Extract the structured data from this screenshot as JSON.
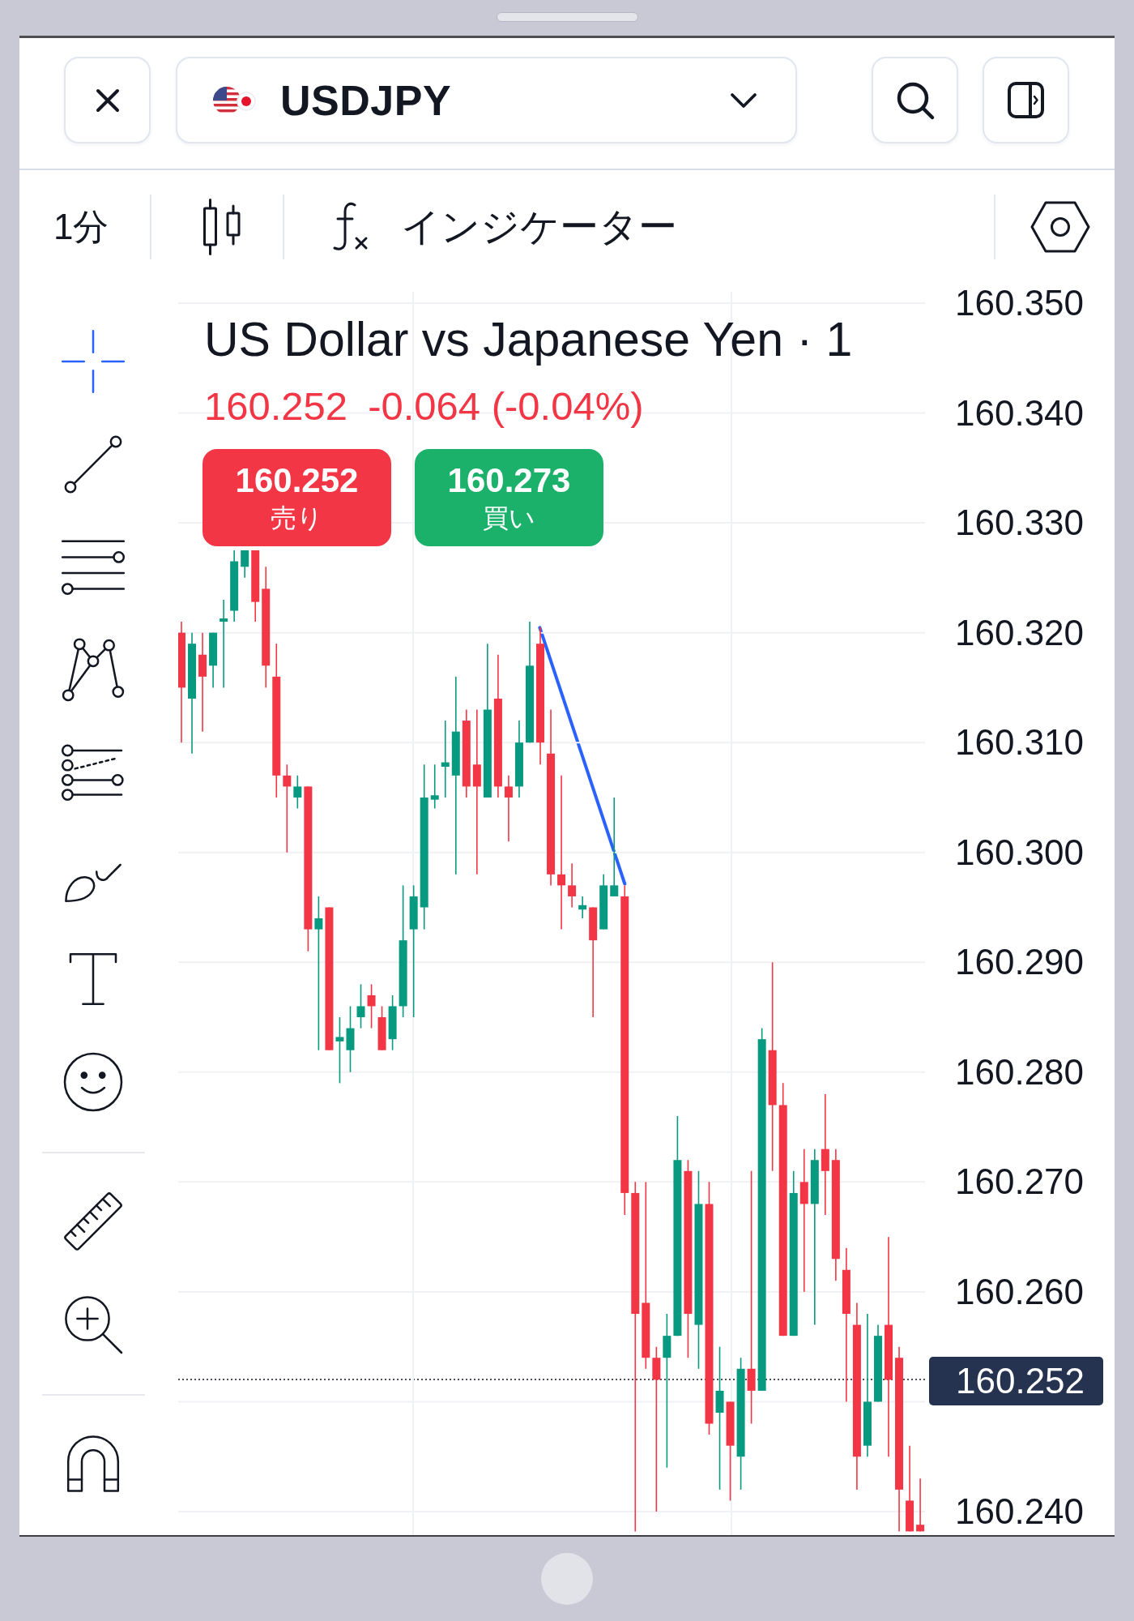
{
  "header": {
    "symbol": "USDJPY"
  },
  "toolbar": {
    "interval": "1分",
    "indicators": "インジケーター"
  },
  "drawing_tool_groups": [
    {
      "tools": [
        {
          "selected": true
        },
        {
          "selected": false
        },
        {
          "selected": false
        },
        {
          "selected": false
        },
        {
          "selected": false
        },
        {
          "selected": false
        },
        {
          "selected": false
        },
        {
          "selected": false
        }
      ]
    },
    {
      "tools": [
        {
          "selected": false
        },
        {
          "selected": false
        }
      ]
    },
    {
      "tools": [
        {
          "selected": false
        }
      ]
    }
  ],
  "chart": {
    "title": "US Dollar vs Japanese Yen · 1",
    "last_price": "160.252",
    "change": "-0.064 (-0.04%)",
    "sell_button": {
      "price": "160.252",
      "label": "売り"
    },
    "buy_button": {
      "price": "160.273",
      "label": "買い"
    },
    "chart_data": {
      "type": "candlestick",
      "grid": true,
      "ohlc": [
        [
          160.32,
          160.321,
          160.31,
          160.315
        ],
        [
          160.314,
          160.32,
          160.309,
          160.319
        ],
        [
          160.318,
          160.32,
          160.311,
          160.316
        ],
        [
          160.317,
          160.32,
          160.315,
          160.32
        ],
        [
          160.321,
          160.323,
          160.315,
          160.3213
        ],
        [
          160.322,
          160.3275,
          160.321,
          160.3265
        ],
        [
          160.326,
          160.3275,
          160.325,
          160.3275
        ],
        [
          160.3275,
          160.3275,
          160.321,
          160.3228
        ],
        [
          160.324,
          160.326,
          160.315,
          160.317
        ],
        [
          160.316,
          160.319,
          160.305,
          160.307
        ],
        [
          160.307,
          160.308,
          160.3,
          160.306
        ],
        [
          160.305,
          160.307,
          160.304,
          160.306
        ],
        [
          160.306,
          160.306,
          160.291,
          160.293
        ],
        [
          160.293,
          160.296,
          160.282,
          160.294
        ],
        [
          160.295,
          160.295,
          160.282,
          160.282
        ],
        [
          160.2828,
          160.285,
          160.279,
          160.2832
        ],
        [
          160.282,
          160.286,
          160.28,
          160.284
        ],
        [
          160.285,
          160.288,
          160.284,
          160.286
        ],
        [
          160.287,
          160.288,
          160.284,
          160.286
        ],
        [
          160.285,
          160.286,
          160.282,
          160.282
        ],
        [
          160.283,
          160.287,
          160.282,
          160.286
        ],
        [
          160.286,
          160.297,
          160.285,
          160.292
        ],
        [
          160.293,
          160.297,
          160.285,
          160.296
        ],
        [
          160.295,
          160.308,
          160.293,
          160.305
        ],
        [
          160.3048,
          160.308,
          160.304,
          160.3052
        ],
        [
          160.3078,
          160.312,
          160.305,
          160.3082
        ],
        [
          160.307,
          160.316,
          160.298,
          160.311
        ],
        [
          160.312,
          160.313,
          160.305,
          160.306
        ],
        [
          160.308,
          160.313,
          160.298,
          160.306
        ],
        [
          160.305,
          160.319,
          160.305,
          160.313
        ],
        [
          160.314,
          160.318,
          160.305,
          160.306
        ],
        [
          160.306,
          160.307,
          160.301,
          160.305
        ],
        [
          160.306,
          160.312,
          160.305,
          160.31
        ],
        [
          160.31,
          160.321,
          160.31,
          160.317
        ],
        [
          160.319,
          160.3205,
          160.308,
          160.31
        ],
        [
          160.309,
          160.313,
          160.297,
          160.298
        ],
        [
          160.298,
          160.307,
          160.293,
          160.297
        ],
        [
          160.297,
          160.299,
          160.295,
          160.296
        ],
        [
          160.2948,
          160.296,
          160.294,
          160.2952
        ],
        [
          160.295,
          160.295,
          160.285,
          160.292
        ],
        [
          160.293,
          160.298,
          160.293,
          160.297
        ],
        [
          160.296,
          160.305,
          160.296,
          160.297
        ],
        [
          160.296,
          160.297,
          160.267,
          160.269
        ],
        [
          160.269,
          160.27,
          160.2382,
          160.258
        ],
        [
          160.259,
          160.27,
          160.253,
          160.254
        ],
        [
          160.254,
          160.255,
          160.24,
          160.252
        ],
        [
          160.254,
          160.258,
          160.244,
          160.256
        ],
        [
          160.256,
          160.276,
          160.256,
          160.272
        ],
        [
          160.271,
          160.272,
          160.254,
          160.258
        ],
        [
          160.257,
          160.271,
          160.253,
          160.268
        ],
        [
          160.268,
          160.27,
          160.247,
          160.248
        ],
        [
          160.249,
          160.255,
          160.242,
          160.251
        ],
        [
          160.25,
          160.25,
          160.241,
          160.246
        ],
        [
          160.245,
          160.254,
          160.242,
          160.253
        ],
        [
          160.253,
          160.271,
          160.248,
          160.251
        ],
        [
          160.251,
          160.284,
          160.251,
          160.283
        ],
        [
          160.282,
          160.29,
          160.271,
          160.277
        ],
        [
          160.277,
          160.279,
          160.256,
          160.256
        ],
        [
          160.256,
          160.271,
          160.256,
          160.269
        ],
        [
          160.27,
          160.273,
          160.26,
          160.268
        ],
        [
          160.268,
          160.273,
          160.257,
          160.272
        ],
        [
          160.273,
          160.278,
          160.267,
          160.271
        ],
        [
          160.272,
          160.273,
          160.261,
          160.263
        ],
        [
          160.262,
          160.264,
          160.25,
          160.258
        ],
        [
          160.257,
          160.259,
          160.242,
          160.245
        ],
        [
          160.246,
          160.258,
          160.245,
          160.25
        ],
        [
          160.25,
          160.257,
          160.25,
          160.256
        ],
        [
          160.257,
          160.265,
          160.245,
          160.252
        ],
        [
          160.254,
          160.255,
          160.2382,
          160.242
        ],
        [
          160.241,
          160.246,
          160.2382,
          160.2382
        ],
        [
          160.2388,
          160.243,
          160.2382,
          160.2382
        ]
      ],
      "ylim": [
        160.24,
        160.35
      ],
      "yticks": [
        {
          "value": 160.35,
          "label": "160.350"
        },
        {
          "value": 160.34,
          "label": "160.340"
        },
        {
          "value": 160.33,
          "label": "160.330"
        },
        {
          "value": 160.32,
          "label": "160.320"
        },
        {
          "value": 160.31,
          "label": "160.310"
        },
        {
          "value": 160.3,
          "label": "160.300"
        },
        {
          "value": 160.29,
          "label": "160.290"
        },
        {
          "value": 160.28,
          "label": "160.280"
        },
        {
          "value": 160.27,
          "label": "160.270"
        },
        {
          "value": 160.26,
          "label": "160.260"
        },
        {
          "value": 160.24,
          "label": "160.240"
        }
      ]
    },
    "current_price": "160.252"
  }
}
